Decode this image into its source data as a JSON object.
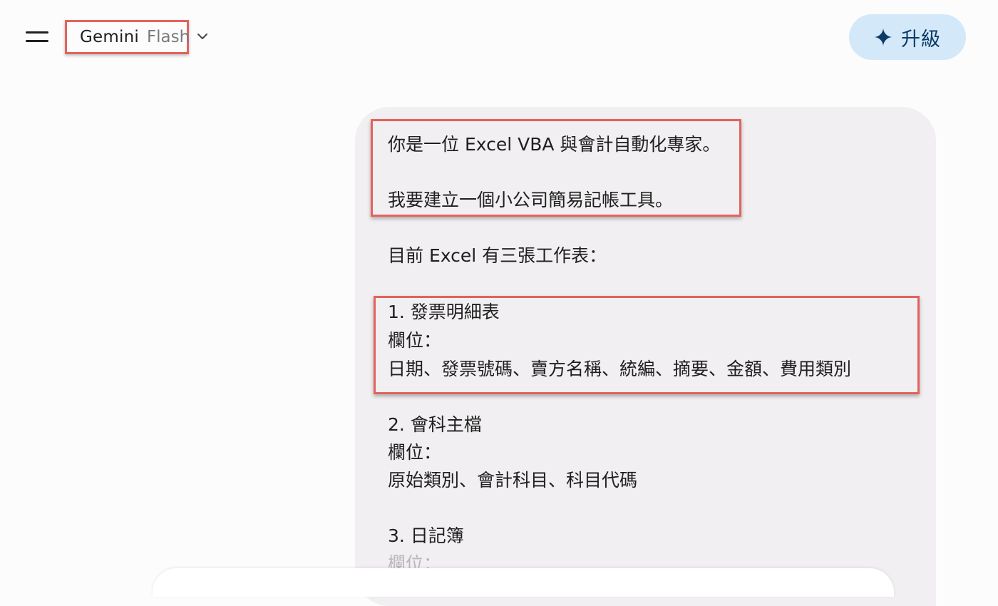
{
  "header": {
    "model_name": "Gemini",
    "model_variant": "Flash",
    "upgrade_label": "升級"
  },
  "icons": {
    "menu": "hamburger-menu-icon",
    "dropdown": "chevron-down-icon",
    "upgrade": "sparkle-icon"
  },
  "colors": {
    "highlight_box": "#e2635c",
    "upgrade_bg": "#d3e8f8",
    "upgrade_text": "#0b3b66",
    "bubble_bg": "#f1eff1"
  },
  "message": {
    "lines": [
      "你是一位 Excel VBA 與會計自動化專家。",
      "我要建立一個小公司簡易記帳工具。",
      "目前 Excel 有三張工作表：",
      "1. 發票明細表",
      "欄位：",
      "日期、發票號碼、賣方名稱、統編、摘要、金額、費用類別",
      "2. 會科主檔",
      "欄位：",
      "原始類別、會計科目、科目代碼",
      "3. 日記簿",
      "欄位："
    ]
  }
}
